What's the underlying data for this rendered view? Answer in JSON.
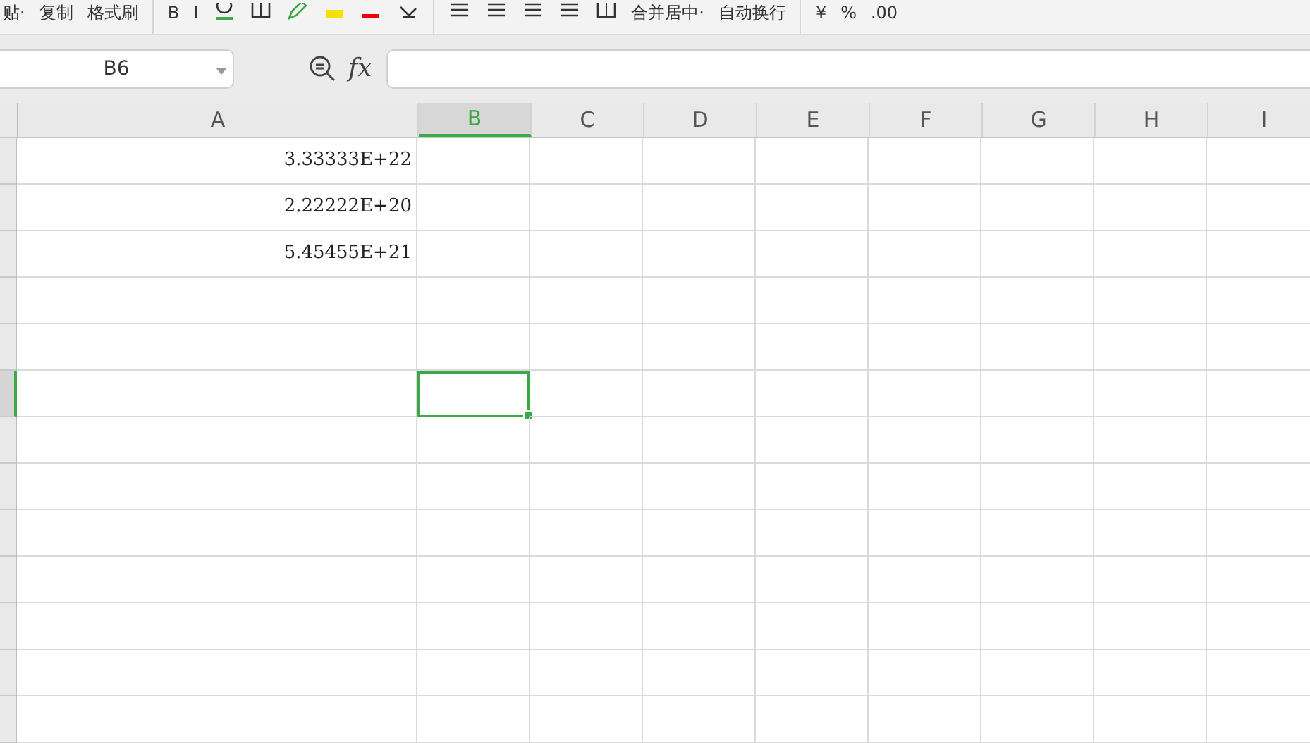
{
  "toolbar": {
    "items": [
      {
        "kind": "text",
        "label": "贴·"
      },
      {
        "kind": "text",
        "label": "复制"
      },
      {
        "kind": "text",
        "label": "格式刷"
      },
      {
        "kind": "sep"
      },
      {
        "kind": "text",
        "label": "B"
      },
      {
        "kind": "text",
        "label": "I"
      },
      {
        "kind": "underline"
      },
      {
        "kind": "border"
      },
      {
        "kind": "pen"
      },
      {
        "kind": "highlight"
      },
      {
        "kind": "fontcolor"
      },
      {
        "kind": "eraser"
      },
      {
        "kind": "sep"
      },
      {
        "kind": "align"
      },
      {
        "kind": "align"
      },
      {
        "kind": "align"
      },
      {
        "kind": "align"
      },
      {
        "kind": "border"
      },
      {
        "kind": "text",
        "label": "合并居中·"
      },
      {
        "kind": "text",
        "label": "自动换行"
      },
      {
        "kind": "sep"
      },
      {
        "kind": "text",
        "label": "¥"
      },
      {
        "kind": "text",
        "label": "%"
      },
      {
        "kind": "text",
        "label": ".00"
      }
    ]
  },
  "name_box": {
    "value": "B6"
  },
  "formula_bar": {
    "function_label": "fx"
  },
  "columns": [
    {
      "label": "A",
      "selected": false
    },
    {
      "label": "B",
      "selected": true
    },
    {
      "label": "C",
      "selected": false
    },
    {
      "label": "D",
      "selected": false
    },
    {
      "label": "E",
      "selected": false
    },
    {
      "label": "F",
      "selected": false
    },
    {
      "label": "G",
      "selected": false
    },
    {
      "label": "H",
      "selected": false
    },
    {
      "label": "I",
      "selected": false
    }
  ],
  "rows": [
    {
      "selected": false,
      "cells": [
        "3.33333E+22"
      ]
    },
    {
      "selected": false,
      "cells": [
        "2.22222E+20"
      ]
    },
    {
      "selected": false,
      "cells": [
        "5.45455E+21"
      ]
    },
    {
      "selected": false,
      "cells": []
    },
    {
      "selected": false,
      "cells": []
    },
    {
      "selected": true,
      "cells": []
    },
    {
      "selected": false,
      "cells": []
    },
    {
      "selected": false,
      "cells": []
    },
    {
      "selected": false,
      "cells": []
    },
    {
      "selected": false,
      "cells": []
    },
    {
      "selected": false,
      "cells": []
    },
    {
      "selected": false,
      "cells": []
    },
    {
      "selected": false,
      "cells": []
    }
  ]
}
